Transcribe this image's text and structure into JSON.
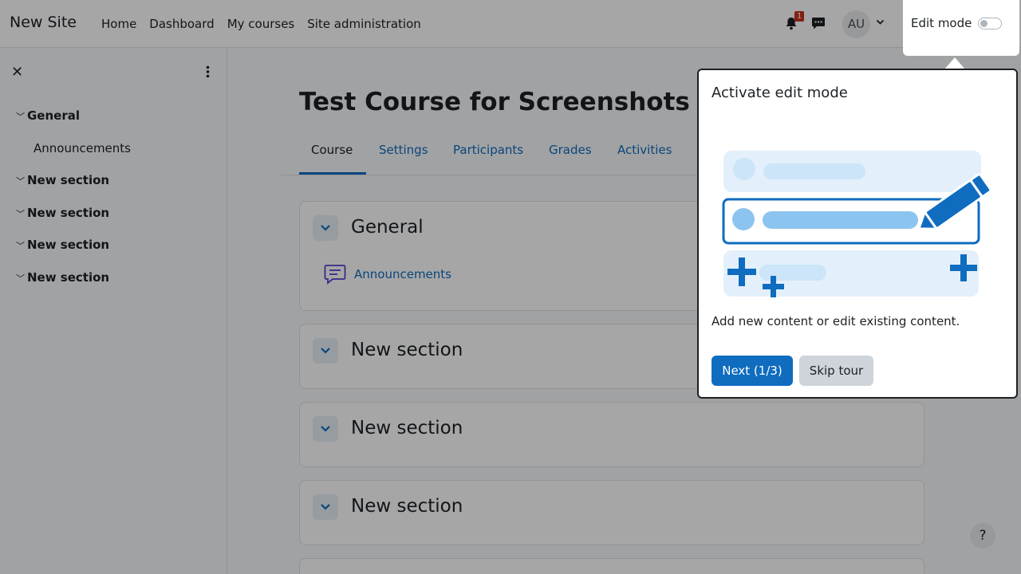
{
  "navbar": {
    "brand": "New Site",
    "links": [
      "Home",
      "Dashboard",
      "My courses",
      "Site administration"
    ],
    "notification_count": "1",
    "avatar_initials": "AU",
    "edit_mode_label": "Edit mode"
  },
  "drawer": {
    "close_icon": "close-icon",
    "items": [
      {
        "type": "section",
        "label": "General"
      },
      {
        "type": "activity",
        "label": "Announcements"
      },
      {
        "type": "section",
        "label": "New section"
      },
      {
        "type": "section",
        "label": "New section"
      },
      {
        "type": "section",
        "label": "New section"
      },
      {
        "type": "section",
        "label": "New section"
      }
    ]
  },
  "main": {
    "title": "Test Course for Screenshots",
    "tabs": [
      "Course",
      "Settings",
      "Participants",
      "Grades",
      "Activities"
    ],
    "sections": [
      {
        "title": "General",
        "activity": "Announcements"
      },
      {
        "title": "New section"
      },
      {
        "title": "New section"
      },
      {
        "title": "New section"
      }
    ]
  },
  "tour": {
    "title": "Activate edit mode",
    "body": "Add new content or edit existing content.",
    "next_label": "Next (1/3)",
    "skip_label": "Skip tour"
  },
  "help_label": "?",
  "colors": {
    "brand_blue": "#0f6cbf",
    "badge_red": "#ca3120",
    "overlay": "rgba(0,0,0,0.35)"
  }
}
